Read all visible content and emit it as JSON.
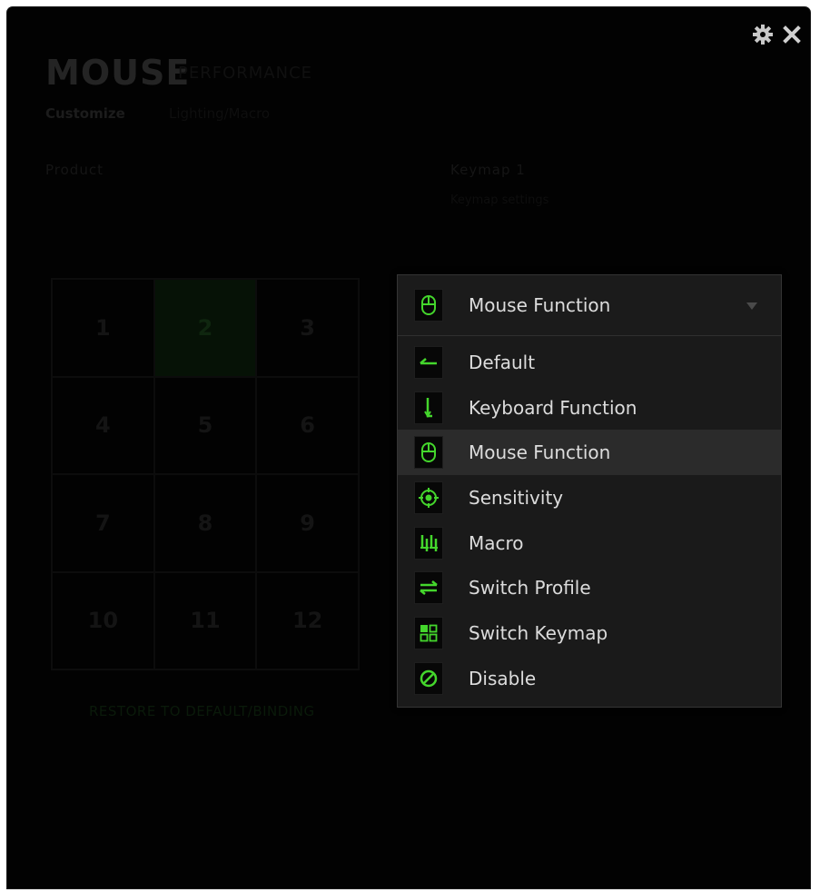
{
  "background": {
    "title": "MOUSE",
    "title_secondary": "PERFORMANCE",
    "tab_customize": "Customize",
    "tab_secondary": "Lighting/Macro",
    "section_product": "Product",
    "section_keymap": "Keymap 1",
    "section_keymap_sub": "Keymap settings",
    "keys": [
      "1",
      "2",
      "3",
      "4",
      "5",
      "6",
      "7",
      "8",
      "9",
      "10",
      "11",
      "12"
    ],
    "active_key": "2",
    "bottom_link": "RESTORE TO DEFAULT/BINDING"
  },
  "dropdown": {
    "selected_label": "Mouse Function",
    "selected_icon": "mouse-icon",
    "items": [
      {
        "label": "Default",
        "icon": "default-arrow-icon"
      },
      {
        "label": "Keyboard Function",
        "icon": "keyboard-function-icon"
      },
      {
        "label": "Mouse Function",
        "icon": "mouse-icon",
        "selected": true
      },
      {
        "label": "Sensitivity",
        "icon": "crosshair-icon"
      },
      {
        "label": "Macro",
        "icon": "macro-icon"
      },
      {
        "label": "Switch Profile",
        "icon": "switch-arrows-icon"
      },
      {
        "label": "Switch Keymap",
        "icon": "grid-icon"
      },
      {
        "label": "Disable",
        "icon": "disable-icon"
      }
    ]
  },
  "colors": {
    "accent": "#44d62c",
    "background": "#020202",
    "dropdown_bg": "#1a1a1a",
    "selected_bg": "#2b2b2b",
    "text": "#dcdcdc"
  }
}
